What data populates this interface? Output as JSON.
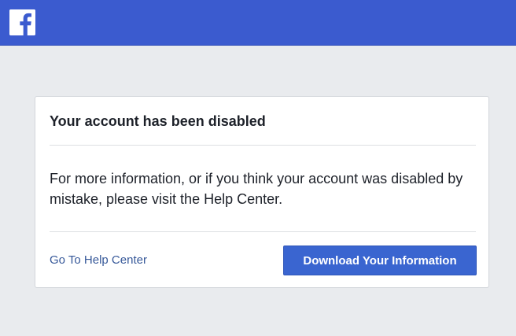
{
  "header": {
    "logo_icon": "facebook-f-icon",
    "background_color": "#3b5bcf"
  },
  "dialog": {
    "title": "Your account has been disabled",
    "message": "For more information, or if you think your account was disabled by mistake, please visit the Help Center.",
    "help_link_label": "Go To Help Center",
    "download_button_label": "Download Your Information",
    "accent_color": "#3a65d0",
    "link_color": "#365899"
  }
}
